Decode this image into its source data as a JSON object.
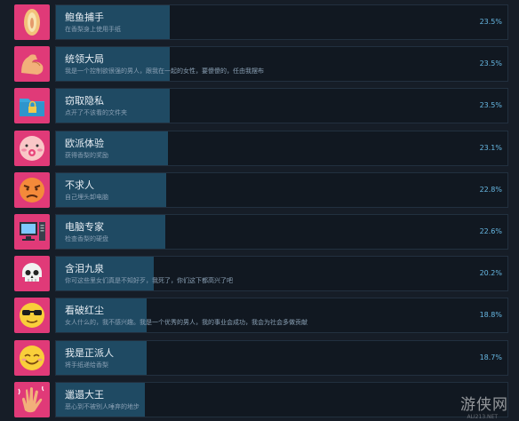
{
  "achievements": [
    {
      "title": "鲍鱼捕手",
      "desc": "在香梨身上使用手纸",
      "percent": "23.5%",
      "progress": 0.235,
      "icon": "abalone-icon"
    },
    {
      "title": "统领大局",
      "desc": "我是一个控制欲很强的男人，跟我在一起的女性，要傻傻的，任由我摆布",
      "percent": "23.5%",
      "progress": 0.235,
      "icon": "flexed-bicep-icon"
    },
    {
      "title": "窃取隐私",
      "desc": "点开了不该看的文件夹",
      "percent": "23.5%",
      "progress": 0.235,
      "icon": "locked-folder-icon"
    },
    {
      "title": "欧派体验",
      "desc": "获得香梨的奖励",
      "percent": "23.1%",
      "progress": 0.231,
      "icon": "blushing-face-icon"
    },
    {
      "title": "不求人",
      "desc": "自己埋头卸电脑",
      "percent": "22.8%",
      "progress": 0.228,
      "icon": "angry-face-icon"
    },
    {
      "title": "电脑专家",
      "desc": "检查香梨的硬盘",
      "percent": "22.6%",
      "progress": 0.226,
      "icon": "computer-icon"
    },
    {
      "title": "含泪九泉",
      "desc": "你可这些里女们真是不知好歹，我死了，你们这下都高兴了吧",
      "percent": "20.2%",
      "progress": 0.202,
      "icon": "skull-icon"
    },
    {
      "title": "看破红尘",
      "desc": "女人什么的，我不感兴趣。我是一个优秀的男人，我的事业会成功，我会为社会多做贡献",
      "percent": "18.8%",
      "progress": 0.188,
      "icon": "sunglasses-face-icon"
    },
    {
      "title": "我是正派人",
      "desc": "将手纸递给香梨",
      "percent": "18.7%",
      "progress": 0.187,
      "icon": "smiling-face-icon"
    },
    {
      "title": "邋遢大王",
      "desc": "恶心到不被别人唾弃的地步",
      "percent": "",
      "progress": 0.183,
      "icon": "waving-hand-icon"
    }
  ],
  "watermark": "游侠网",
  "watermark_sub": "ALI213.NET"
}
